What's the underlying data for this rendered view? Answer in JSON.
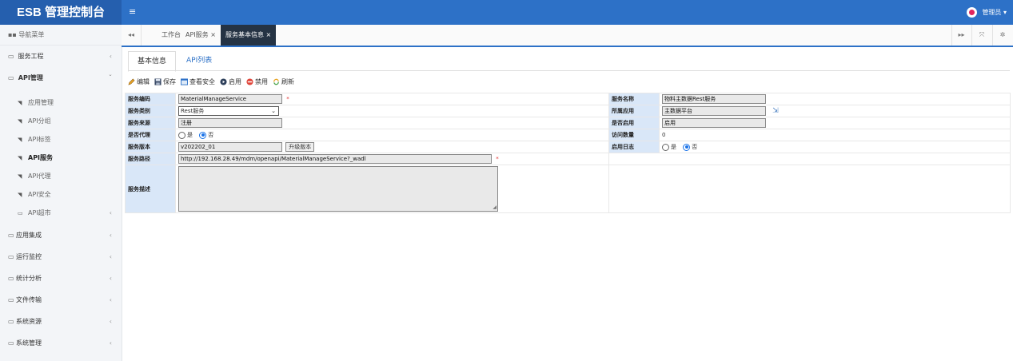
{
  "header": {
    "brand": "ESB 管理控制台",
    "menu_icon": "hamburger-icon",
    "user_label": "管理员 ▾"
  },
  "sidebar": {
    "title": "导航菜单",
    "items": [
      {
        "label": "服务工程",
        "chevron": "‹"
      },
      {
        "label": "API管理",
        "chevron": "ˇ"
      }
    ],
    "sub_items": [
      {
        "label": "应用管理"
      },
      {
        "label": "API分组"
      },
      {
        "label": "API标签"
      },
      {
        "label": "API服务"
      },
      {
        "label": "API代理"
      },
      {
        "label": "API安全"
      },
      {
        "label": "API超市",
        "chevron": "‹"
      }
    ],
    "lower_items": [
      {
        "label": "应用集成",
        "chevron": "‹"
      },
      {
        "label": "运行监控",
        "chevron": "‹"
      },
      {
        "label": "统计分析",
        "chevron": "‹"
      },
      {
        "label": "文件传输",
        "chevron": "‹"
      },
      {
        "label": "系统资源",
        "chevron": "‹"
      },
      {
        "label": "系统管理",
        "chevron": "‹"
      }
    ]
  },
  "tabbar": {
    "prev": "◂◂",
    "next": "▸▸",
    "fullscreen": "⤧",
    "settings": "✲",
    "tabs": [
      {
        "label": "工作台"
      },
      {
        "label": "API服务 ×"
      },
      {
        "label": "服务基本信息 ×"
      }
    ]
  },
  "subtabs": {
    "basic": "基本信息",
    "api_list": "API列表"
  },
  "toolbar": {
    "edit": "编辑",
    "save": "保存",
    "view_security": "查看安全",
    "enable": "启用",
    "disable": "禁用",
    "refresh": "刷新"
  },
  "form": {
    "service_code_label": "服务编码",
    "service_code": "MaterialManageService",
    "service_name_label": "服务名称",
    "service_name": "物料主数据Rest服务",
    "service_type_label": "服务类别",
    "service_type": "Rest服务",
    "app_label": "所属应用",
    "app": "主数据平台",
    "source_label": "服务来源",
    "source": "注册",
    "enabled_label": "是否启用",
    "enabled": "启用",
    "proxy_label": "是否代理",
    "yes": "是",
    "no": "否",
    "visit_count_label": "访问数量",
    "visit_count": "0",
    "version_label": "服务版本",
    "version": "v202202_01",
    "upgrade_button": "升级版本",
    "log_label": "启用日志",
    "path_label": "服务路径",
    "path": "http://192.168.28.49/mdm/openapi/MaterialManageService?_wadl",
    "desc_label": "服务描述",
    "required": "*"
  }
}
